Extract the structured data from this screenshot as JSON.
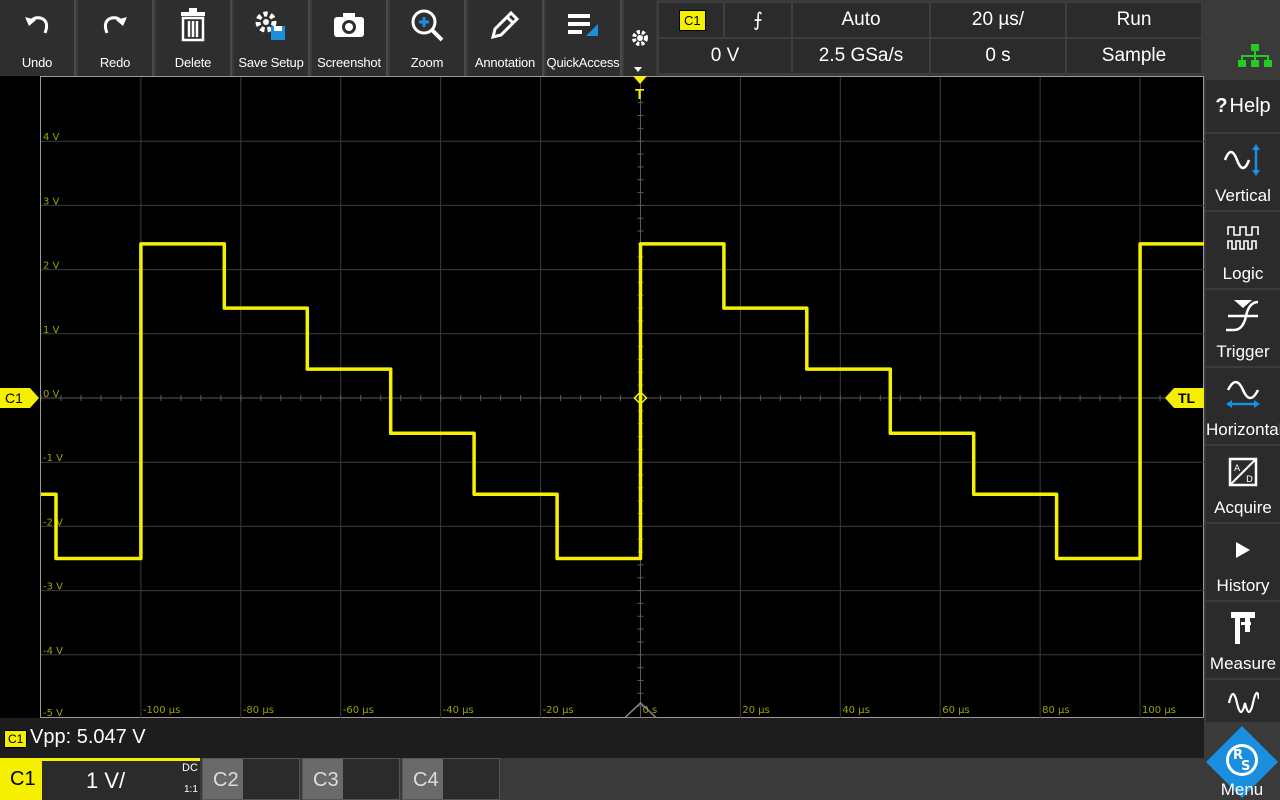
{
  "toolbar": {
    "buttons": [
      {
        "label": "Undo",
        "icon": "undo-icon"
      },
      {
        "label": "Redo",
        "icon": "redo-icon"
      },
      {
        "label": "Delete",
        "icon": "trash-icon"
      },
      {
        "label": "Save Setup",
        "icon": "save-setup-icon"
      },
      {
        "label": "Screenshot",
        "icon": "camera-icon"
      },
      {
        "label": "Zoom",
        "icon": "zoom-in-icon"
      },
      {
        "label": "Annotation",
        "icon": "pencil-icon"
      },
      {
        "label": "QuickAccess",
        "icon": "quick-access-icon"
      }
    ]
  },
  "status": {
    "trigger_source": "C1",
    "trigger_slope": "⨍",
    "trigger_mode": "Auto",
    "timebase": "20 µs/",
    "run_state": "Run",
    "trigger_level": "0 V",
    "sample_rate": "2.5 GSa/s",
    "horizontal_position": "0 s",
    "acquisition_mode": "Sample"
  },
  "side_panel": {
    "help_label": "Help",
    "items": [
      {
        "label": "Vertical",
        "icon": "vertical-icon"
      },
      {
        "label": "Logic",
        "icon": "logic-icon"
      },
      {
        "label": "Trigger",
        "icon": "trigger-icon"
      },
      {
        "label": "Horizontal",
        "icon": "horizontal-icon"
      },
      {
        "label": "Acquire",
        "icon": "acquire-icon"
      },
      {
        "label": "History",
        "icon": "play-icon"
      },
      {
        "label": "Measure",
        "icon": "caliper-icon"
      }
    ],
    "menu_label": "Menu"
  },
  "graticule": {
    "y_labels": [
      "4 V",
      "3 V",
      "2 V",
      "1 V",
      "0 V",
      "-1 V",
      "-2 V",
      "-3 V",
      "-4 V",
      "-5 V"
    ],
    "x_labels": [
      "-100 µs",
      "-80 µs",
      "-60 µs",
      "-40 µs",
      "-20 µs",
      "0 s",
      "20 µs",
      "40 µs",
      "60 µs",
      "80 µs",
      "100 µs"
    ],
    "c1_marker": "C1",
    "tl_marker": "TL",
    "trigger_marker": "T",
    "trace_color": "#f5f000",
    "grid_color": "#3c3c3c"
  },
  "chart_data": {
    "type": "line",
    "xlabel": "",
    "ylabel": "",
    "xlim": [
      -120,
      113
    ],
    "ylim": [
      -5,
      5
    ],
    "series": [
      {
        "x": [
          -120,
          -117,
          -117,
          -100,
          -100,
          -83.3,
          -83.3,
          -66.7,
          -66.7,
          -50,
          -50,
          -33.3,
          -33.3,
          -16.7,
          -16.7,
          0,
          0,
          16.7,
          16.7,
          33.3,
          33.3,
          50,
          50,
          66.7,
          66.7,
          83.3,
          83.3,
          100,
          100,
          113
        ],
        "y": [
          -1.5,
          -1.5,
          -2.5,
          -2.5,
          2.4,
          2.4,
          1.4,
          1.4,
          0.45,
          0.45,
          -0.55,
          -0.55,
          -1.5,
          -1.5,
          -2.5,
          -2.5,
          2.4,
          2.4,
          1.4,
          1.4,
          0.45,
          0.45,
          -0.55,
          -0.55,
          -1.5,
          -1.5,
          -2.5,
          -2.5,
          2.4,
          2.4
        ]
      }
    ]
  },
  "measurement": {
    "channel": "C1",
    "text": "Vpp: 5.047 V"
  },
  "channels": [
    {
      "name": "C1",
      "scale": "1 V/",
      "coupling": "DC",
      "ratio": "1:1",
      "active": true
    },
    {
      "name": "C2",
      "active": false
    },
    {
      "name": "C3",
      "active": false
    },
    {
      "name": "C4",
      "active": false
    }
  ]
}
